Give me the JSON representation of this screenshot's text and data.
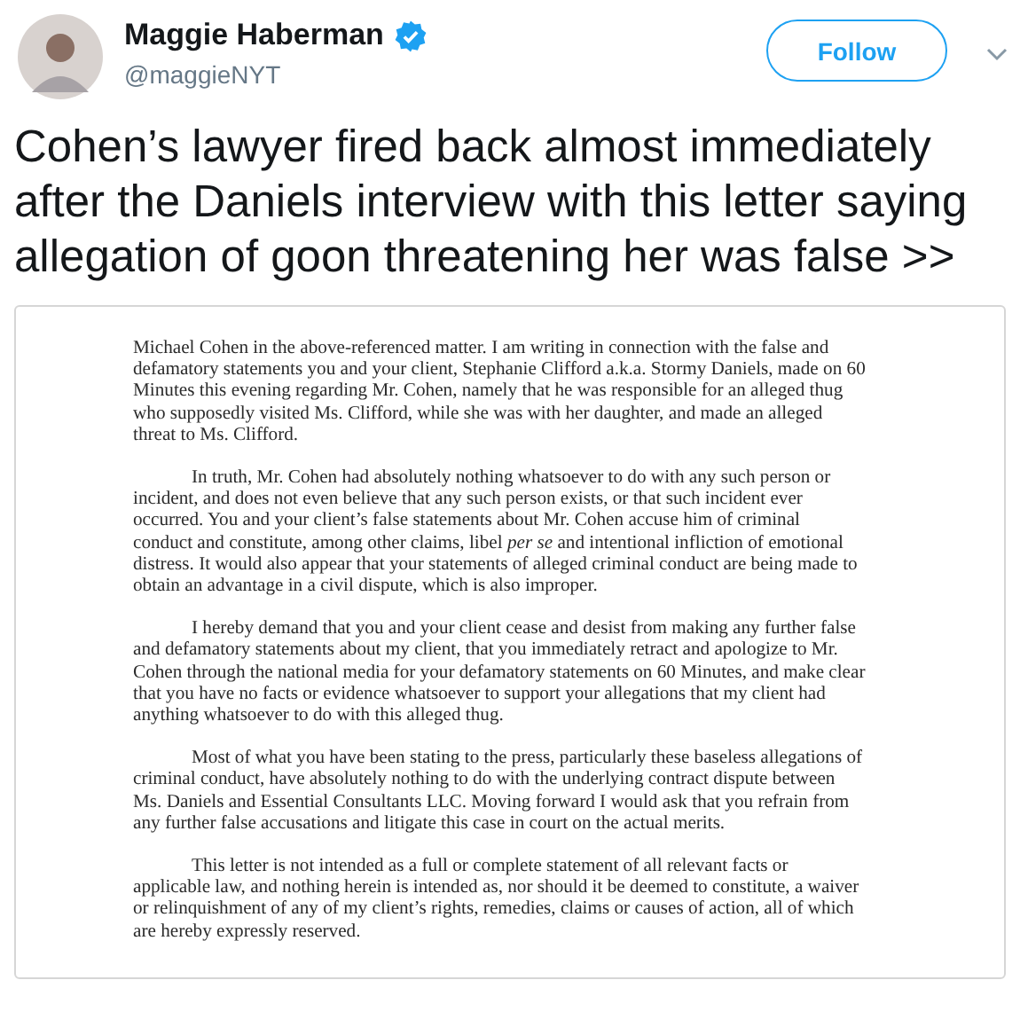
{
  "author": {
    "name": "Maggie Haberman",
    "verified": true,
    "handle": "@maggieNYT"
  },
  "follow_button": "Follow",
  "tweet_text": "Cohen’s lawyer fired back almost immediately after the Daniels interview with this letter saying allegation of goon threatening her was false >>",
  "letter": {
    "paragraphs": [
      {
        "indented": false,
        "lines": [
          "Michael Cohen in the above-referenced matter.  I am writing in connection with the false and",
          "defamatory statements you and your client, Stephanie Clifford a.k.a. Stormy Daniels, made on 60",
          "Minutes this evening regarding Mr. Cohen, namely that he was responsible for an alleged thug",
          "who supposedly visited Ms. Clifford, while she was with her daughter, and made an alleged",
          "threat to Ms. Clifford."
        ]
      },
      {
        "indented": true,
        "lines": [
          "In truth, Mr. Cohen had absolutely nothing whatsoever to do with any such person or",
          "incident, and does not even believe that any such person exists, or that such incident ever",
          "occurred.  You and your client’s false statements about Mr. Cohen accuse him of criminal",
          "conduct and constitute, among other claims, libel *per se* and intentional infliction of emotional",
          "distress.  It would also appear that your statements of alleged criminal conduct are being made to",
          "obtain an advantage in a civil dispute, which is also improper."
        ]
      },
      {
        "indented": true,
        "lines": [
          "I hereby demand that you and your client cease and desist from making any further false",
          "and defamatory statements about my client, that you immediately retract and apologize to Mr.",
          "Cohen through the national media for your defamatory statements on 60 Minutes, and make clear",
          "that you have no facts or evidence whatsoever to support your allegations that my client had",
          "anything whatsoever to do with this alleged thug."
        ]
      },
      {
        "indented": true,
        "lines": [
          "Most of what you have been stating to the press, particularly these baseless allegations of",
          "criminal conduct, have absolutely nothing to do with the underlying contract dispute between",
          "Ms. Daniels and Essential Consultants LLC.  Moving forward I would ask that you refrain from",
          "any further false accusations and litigate this case in court on the actual merits."
        ]
      },
      {
        "indented": true,
        "lines": [
          "This letter is not intended as a full or complete statement of all relevant facts or",
          "applicable law, and nothing herein is intended as, nor should it be deemed to constitute, a waiver",
          "or relinquishment of any of my client’s rights, remedies, claims or causes of action, all of which",
          "are hereby expressly reserved."
        ]
      }
    ]
  }
}
